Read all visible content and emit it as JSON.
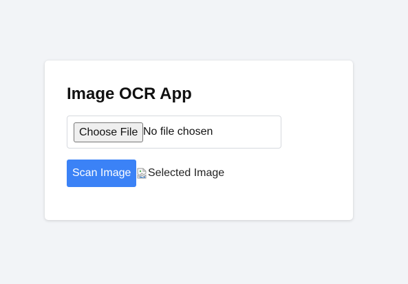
{
  "app": {
    "title": "Image OCR App"
  },
  "file_input": {
    "button_label": "Choose File",
    "status_text": "No file chosen"
  },
  "actions": {
    "scan_label": "Scan Image"
  },
  "preview": {
    "alt_text": "Selected Image",
    "icon": "broken-image-icon"
  },
  "colors": {
    "page_background": "#f2f4f7",
    "card_background": "#ffffff",
    "primary_button": "#3b82f6",
    "primary_button_text": "#ffffff"
  }
}
